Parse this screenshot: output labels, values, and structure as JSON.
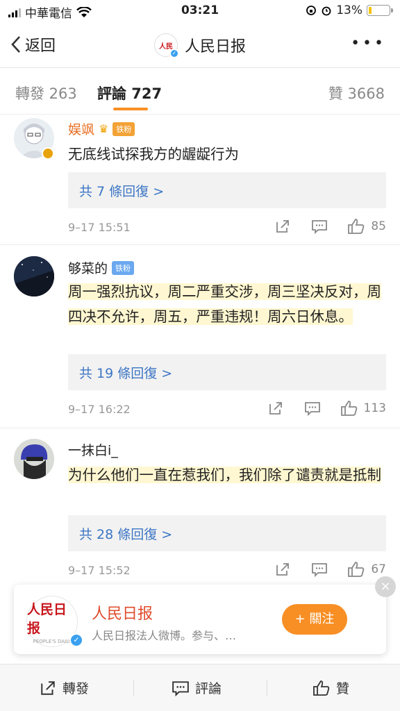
{
  "status": {
    "carrier": "中華電信",
    "time": "03:21",
    "battery": "13%",
    "battery_level": 0.13
  },
  "nav": {
    "back_label": "返回",
    "title": "人民日报",
    "more": "•••"
  },
  "tabs": {
    "repost": "轉發 263",
    "comments": "評論 727",
    "likes": "贊 3668"
  },
  "comments": [
    {
      "username": "娱飒",
      "fan_badge": "铁粉",
      "text": "无底线试探我方的龌龊行为",
      "replies": "共 7 條回復 >",
      "time": "9–17 15:51",
      "likes": "85"
    },
    {
      "username": "够菜的",
      "fan_badge": "铁粉",
      "text": "周一强烈抗议，周二严重交涉，周三坚决反对，周四决不允许，周五，严重违规！周六日休息。",
      "replies": "共 19 條回復 >",
      "time": "9–17 16:22",
      "likes": "113"
    },
    {
      "username": "一抹白i_",
      "text": "为什么他们一直在惹我们，我们除了谴责就是抵制",
      "replies": "共 28 條回復 >",
      "time": "9–17 15:52",
      "likes": "67"
    }
  ],
  "follow_card": {
    "logo_text": "人民日报",
    "logo_sub": "PEOPLE'S DAILY",
    "name": "人民日报",
    "desc": "人民日报法人微博。参与、…",
    "follow_label": "+ 關注",
    "close": "×"
  },
  "bottom_bar": {
    "repost": "轉發",
    "comment": "評論",
    "like": "贊"
  },
  "colors": {
    "accent": "#f88f25",
    "link": "#3d76c4",
    "highlight": "#fff7d1"
  }
}
